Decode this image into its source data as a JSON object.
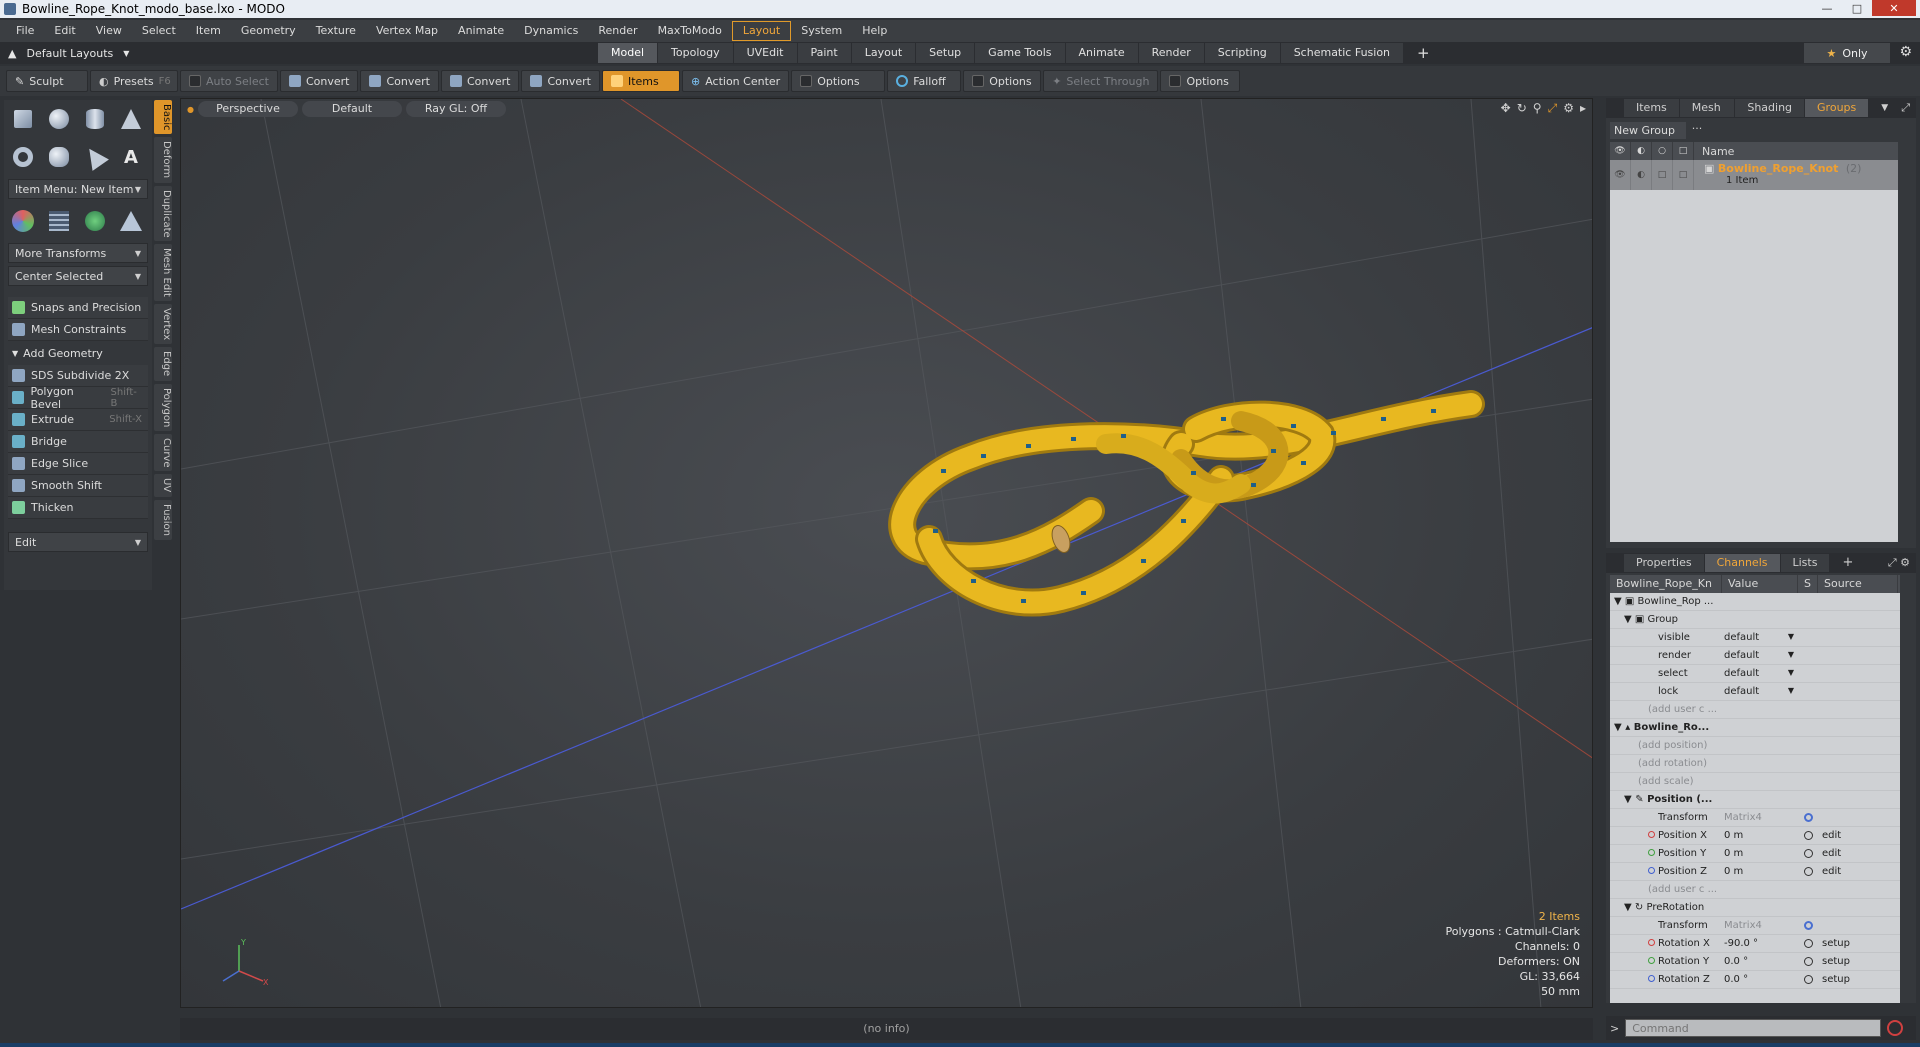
{
  "window": {
    "title": "Bowline_Rope_Knot_modo_base.lxo - MODO"
  },
  "menu": [
    "File",
    "Edit",
    "View",
    "Select",
    "Item",
    "Geometry",
    "Texture",
    "Vertex Map",
    "Animate",
    "Dynamics",
    "Render",
    "MaxToModo",
    "Layout",
    "System",
    "Help"
  ],
  "menu_active": "Layout",
  "layouts": {
    "dropdown": "Default Layouts",
    "tabs": [
      "Model",
      "Topology",
      "UVEdit",
      "Paint",
      "Layout",
      "Setup",
      "Game Tools",
      "Animate",
      "Render",
      "Scripting",
      "Schematic Fusion"
    ],
    "active_tab": "Model",
    "only_label": "Only"
  },
  "toolbar": {
    "sculpt": "Sculpt",
    "presets": "Presets",
    "presets_shortcut": "F6",
    "auto_select": "Auto Select",
    "convert1": "Convert",
    "convert2": "Convert",
    "convert3": "Convert",
    "convert4": "Convert",
    "items": "Items",
    "action_center": "Action Center",
    "options1": "Options",
    "falloff": "Falloff",
    "options2": "Options",
    "select_through": "Select Through",
    "options3": "Options"
  },
  "toolbox": {
    "item_menu": "Item Menu: New Item",
    "more_transforms": "More Transforms",
    "center_selected": "Center Selected",
    "snaps": "Snaps and Precision",
    "mesh_constraints": "Mesh Constraints",
    "add_geometry": "Add Geometry",
    "tools": [
      {
        "label": "SDS Subdivide 2X",
        "shortcut": ""
      },
      {
        "label": "Polygon Bevel",
        "shortcut": "Shift-B"
      },
      {
        "label": "Extrude",
        "shortcut": "Shift-X"
      },
      {
        "label": "Bridge",
        "shortcut": ""
      },
      {
        "label": "Edge Slice",
        "shortcut": ""
      },
      {
        "label": "Smooth Shift",
        "shortcut": ""
      },
      {
        "label": "Thicken",
        "shortcut": ""
      }
    ],
    "edit": "Edit",
    "vtabs": [
      "Basic",
      "Deform",
      "Duplicate",
      "Mesh Edit",
      "Vertex",
      "Edge",
      "Polygon",
      "Curve",
      "UV",
      "Fusion"
    ]
  },
  "viewport": {
    "view": "Perspective",
    "shading": "Default",
    "raygl": "Ray GL: Off",
    "stats": {
      "items": "2 Items",
      "polygons": "Polygons : Catmull-Clark",
      "channels": "Channels: 0",
      "deformers": "Deformers: ON",
      "gl": "GL: 33,664",
      "scale": "50 mm"
    },
    "colors": {
      "rope": "#e8b820",
      "rope_edge": "#a07a10",
      "fleck": "#1e5f8a"
    }
  },
  "status": {
    "info": "(no info)"
  },
  "groups_panel": {
    "tabs": [
      "Items",
      "Mesh ...",
      "Shading",
      "Groups"
    ],
    "active": "Groups",
    "new_group": "New Group",
    "col_name": "Name",
    "group_name": "Bowline_Rope_Knot",
    "group_count": "(2)",
    "group_sub": "1 Item"
  },
  "channels_panel": {
    "tabs": [
      "Properties",
      "Channels",
      "Lists"
    ],
    "active": "Channels",
    "headers": {
      "name": "Bowline_Rope_Kn ...",
      "value": "Value",
      "s": "S",
      "source": "Source"
    },
    "rows": [
      {
        "name": "Bowline_Rop ...",
        "value": "",
        "source": ""
      },
      {
        "name": "Group",
        "value": "",
        "source": ""
      },
      {
        "name": "visible",
        "value": "default",
        "source": ""
      },
      {
        "name": "render",
        "value": "default",
        "source": ""
      },
      {
        "name": "select",
        "value": "default",
        "source": ""
      },
      {
        "name": "lock",
        "value": "default",
        "source": ""
      },
      {
        "name": "(add user c ...",
        "value": "",
        "source": ""
      },
      {
        "name": "Bowline_Ro...",
        "value": "",
        "source": ""
      },
      {
        "name": "(add position)",
        "value": "",
        "source": ""
      },
      {
        "name": "(add rotation)",
        "value": "",
        "source": ""
      },
      {
        "name": "(add scale)",
        "value": "",
        "source": ""
      },
      {
        "name": "Position (...",
        "value": "",
        "source": ""
      },
      {
        "name": "Transform",
        "value": "Matrix4",
        "source": ""
      },
      {
        "name": "Position X",
        "value": "0 m",
        "source": "edit"
      },
      {
        "name": "Position Y",
        "value": "0 m",
        "source": "edit"
      },
      {
        "name": "Position Z",
        "value": "0 m",
        "source": "edit"
      },
      {
        "name": "(add user c ...",
        "value": "",
        "source": ""
      },
      {
        "name": "PreRotation",
        "value": "",
        "source": ""
      },
      {
        "name": "Transform",
        "value": "Matrix4",
        "source": ""
      },
      {
        "name": "Rotation X",
        "value": "-90.0 °",
        "source": "setup"
      },
      {
        "name": "Rotation Y",
        "value": "0.0 °",
        "source": "setup"
      },
      {
        "name": "Rotation Z",
        "value": "0.0 °",
        "source": "setup"
      }
    ]
  },
  "command": {
    "placeholder": "Command"
  }
}
